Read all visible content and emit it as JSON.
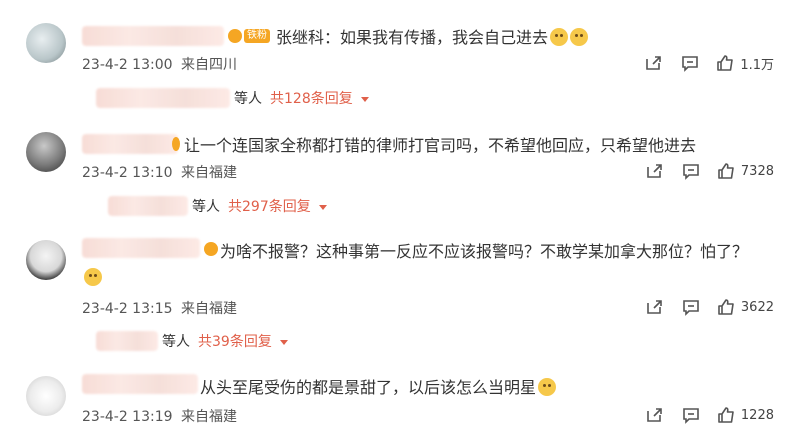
{
  "comments": [
    {
      "text": "张继科：如果我有传播，我会自己进去",
      "badge": "铁粉",
      "time": "23-4-2 13:00",
      "location": "来自四川",
      "likes": "1.1万",
      "reply_suffix": "等人",
      "reply_total": "共128条回复"
    },
    {
      "text": "让一个连国家全称都打错的律师打官司吗，不希望他回应，只希望他进去",
      "time": "23-4-2 13:10",
      "location": "来自福建",
      "likes": "7328",
      "reply_suffix": "等人",
      "reply_total": "共297条回复"
    },
    {
      "text": "为啥不报警？这种事第一反应不应该报警吗？不敢学某加拿大那位？怕了？",
      "time": "23-4-2 13:15",
      "location": "来自福建",
      "likes": "3622",
      "reply_suffix": "等人",
      "reply_total": "共39条回复"
    },
    {
      "text": "从头至尾受伤的都是景甜了，以后该怎么当明星",
      "time": "23-4-2 13:19",
      "location": "来自福建",
      "likes": "1228"
    }
  ],
  "colors": {
    "accent": "#e0604a",
    "text": "#333333",
    "meta": "#555555"
  },
  "icons": [
    "repost-icon",
    "comment-icon",
    "like-icon",
    "chevron-down-icon",
    "emoji-icon"
  ]
}
